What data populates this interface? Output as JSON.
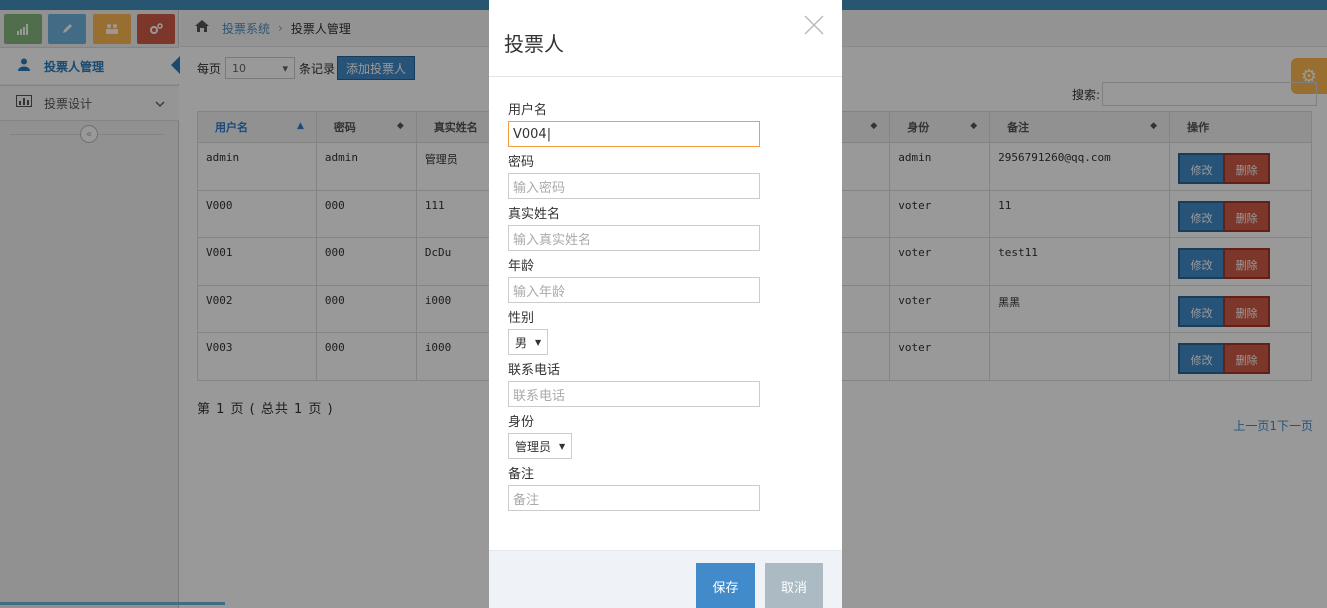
{
  "breadcrumb": {
    "root": "投票系统",
    "current": "投票人管理"
  },
  "sidebar": {
    "items": [
      {
        "label": "投票人管理"
      },
      {
        "label": "投票设计"
      }
    ]
  },
  "toolbar": {
    "perpage_prefix": "每页",
    "perpage_value": "10",
    "perpage_suffix": "条记录",
    "add_label": "添加投票人"
  },
  "search": {
    "label": "搜索:"
  },
  "table": {
    "headers": [
      "用户名",
      "密码",
      "真实姓名",
      "身份",
      "备注",
      "操作"
    ],
    "rows": [
      {
        "username": "admin",
        "password": "admin",
        "realname": "管理员",
        "role": "admin",
        "remark": "2956791260@qq.com"
      },
      {
        "username": "V000",
        "password": "000",
        "realname": "111",
        "role": "voter",
        "remark": "11"
      },
      {
        "username": "V001",
        "password": "000",
        "realname": "DcDu",
        "role": "voter",
        "remark": "test11"
      },
      {
        "username": "V002",
        "password": "000",
        "realname": "i000",
        "role": "voter",
        "remark": "黑黑"
      },
      {
        "username": "V003",
        "password": "000",
        "realname": "i000",
        "role": "voter",
        "remark": ""
      }
    ],
    "edit_label": "修改",
    "delete_label": "删除"
  },
  "pagination": {
    "info": "第 1 页 ( 总共 1 页 )",
    "prev": "上一页",
    "page": "1",
    "next": "下一页"
  },
  "modal": {
    "title": "投票人",
    "close": "×",
    "fields": {
      "username_label": "用户名",
      "username_value": "V004",
      "password_label": "密码",
      "password_placeholder": "输入密码",
      "realname_label": "真实姓名",
      "realname_placeholder": "输入真实姓名",
      "age_label": "年龄",
      "age_placeholder": "输入年龄",
      "gender_label": "性别",
      "gender_value": "男",
      "phone_label": "联系电话",
      "phone_placeholder": "联系电话",
      "role_label": "身份",
      "role_value": "管理员",
      "remark_label": "备注",
      "remark_placeholder": "备注"
    },
    "save_label": "保存",
    "cancel_label": "取消"
  },
  "colors": {
    "primary": "#428bca",
    "danger": "#d15b47",
    "focus": "#f59942",
    "topbar": "#438eb9"
  }
}
